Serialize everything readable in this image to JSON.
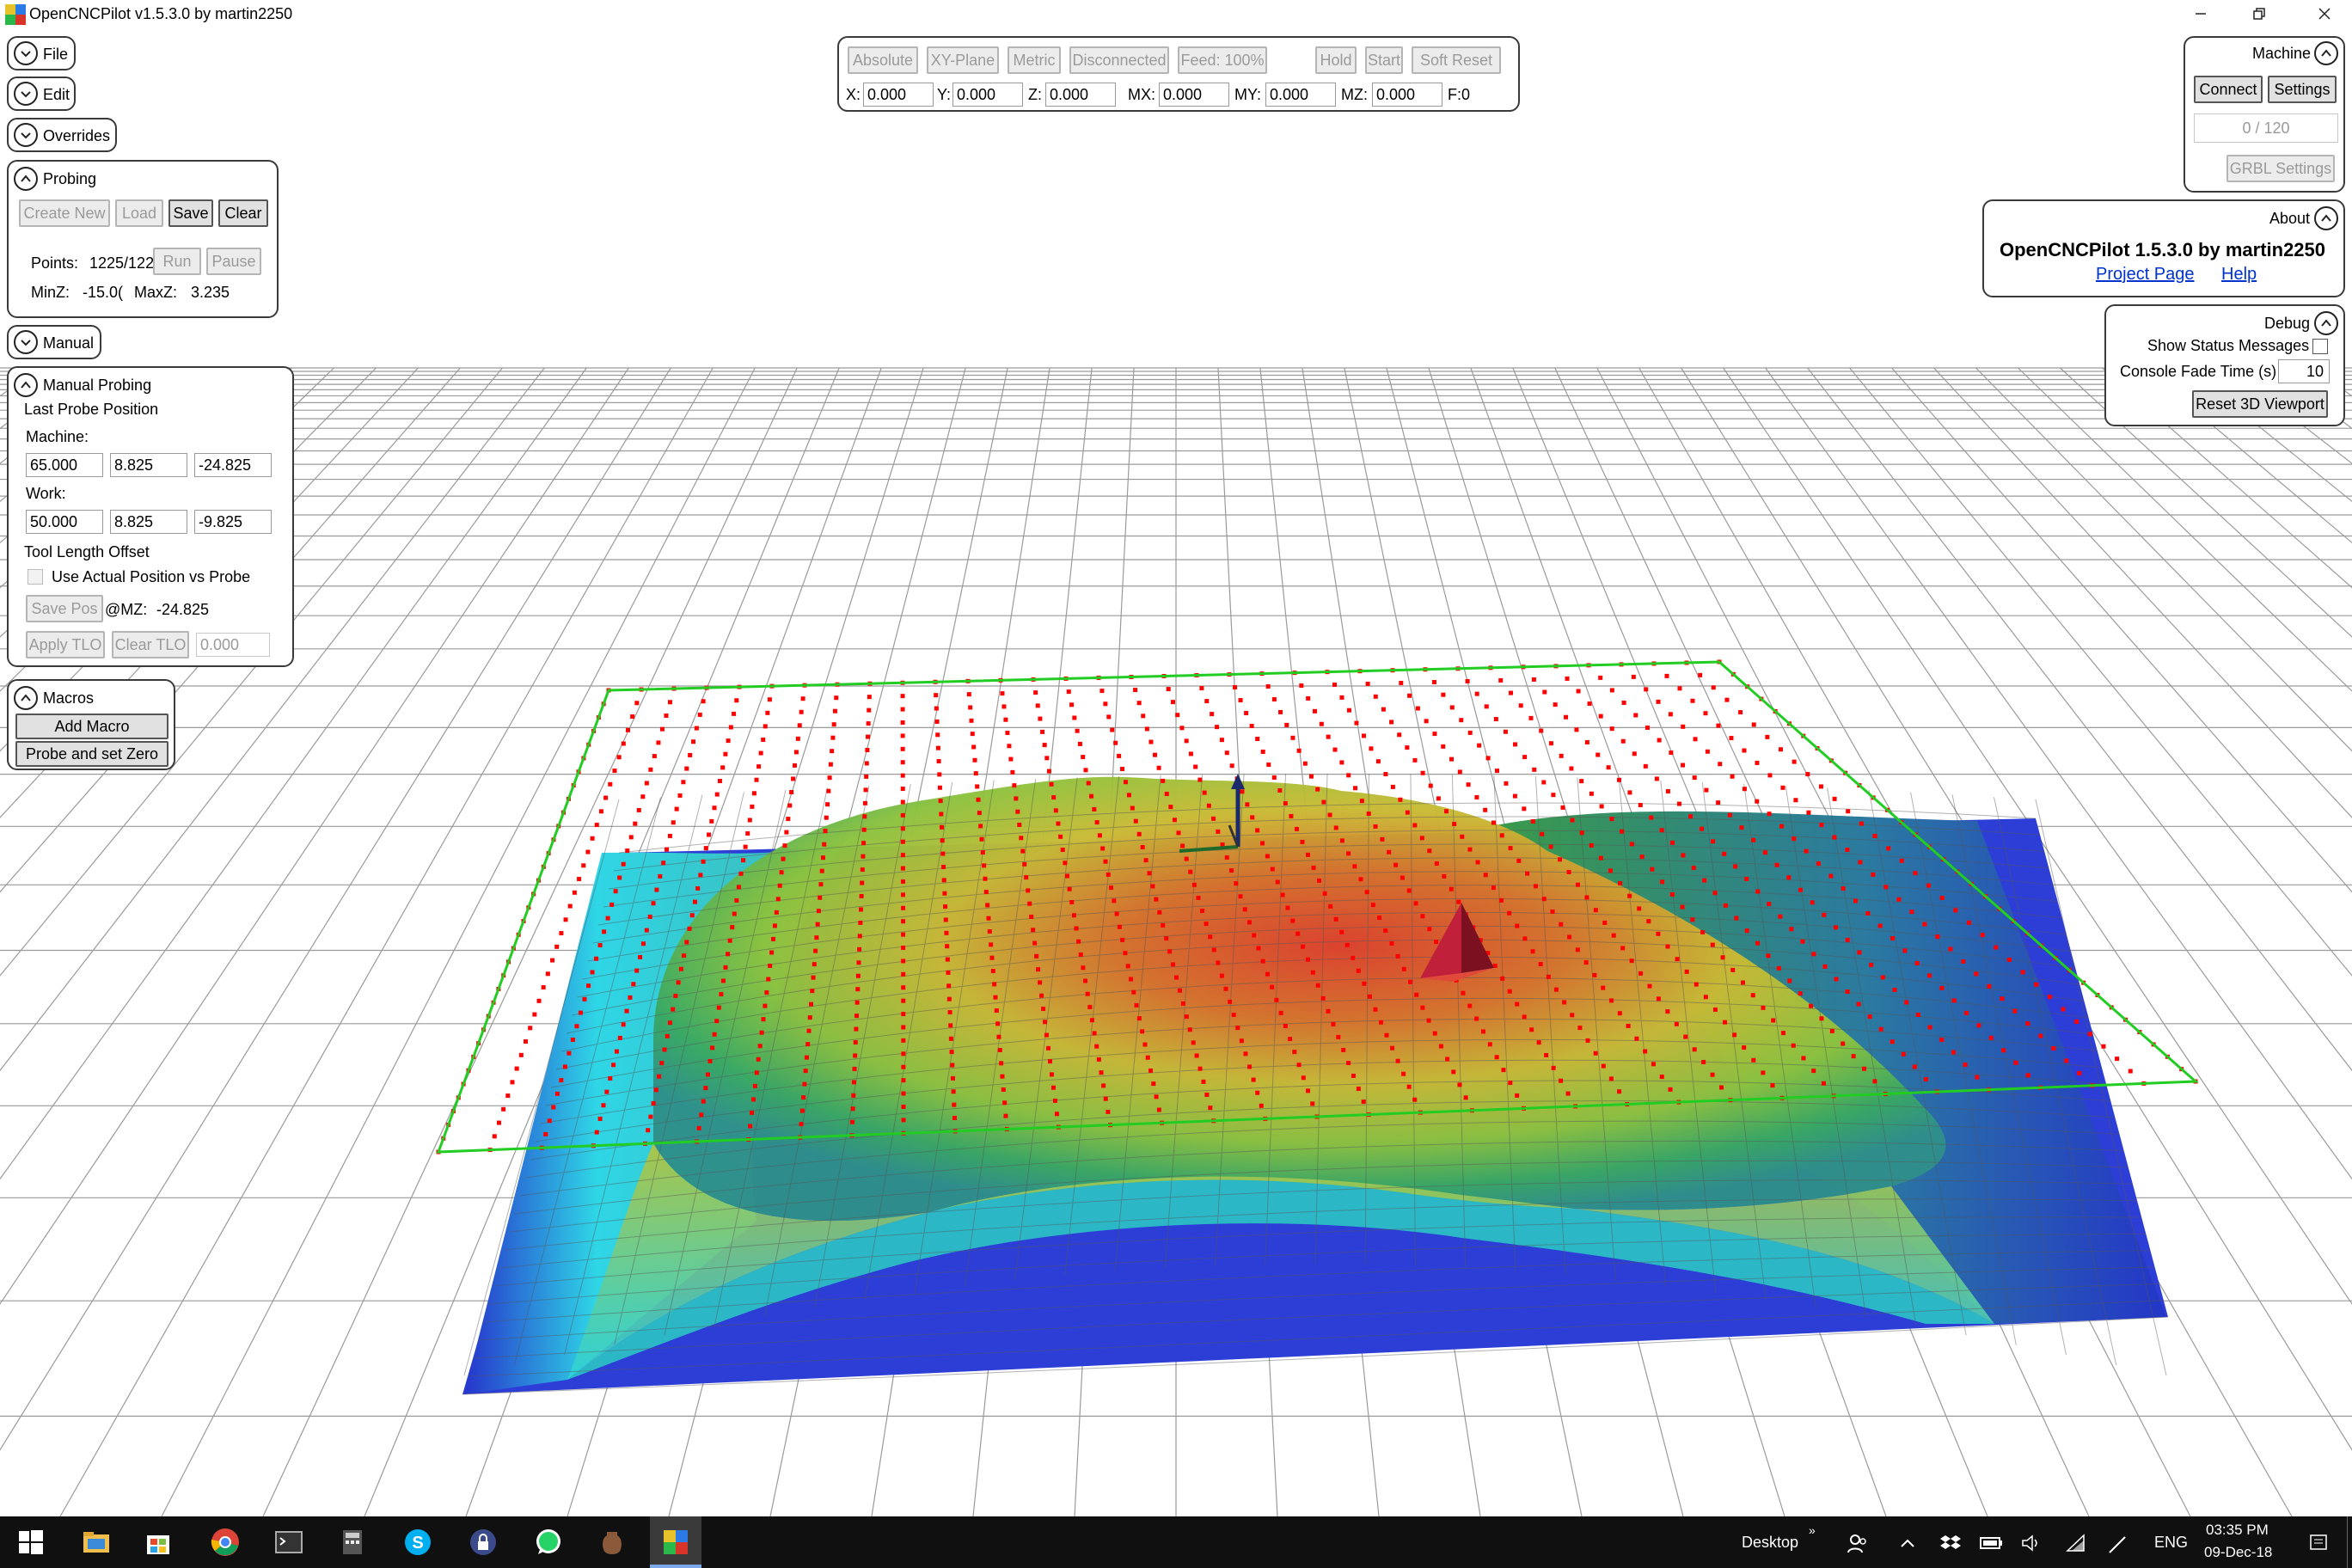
{
  "window": {
    "title": "OpenCNCPilot v1.5.3.0 by martin2250",
    "minimize_icon": "minimize-icon",
    "restore_icon": "restore-icon",
    "close_icon": "close-icon"
  },
  "nav": {
    "file_label": "File",
    "edit_label": "Edit",
    "overrides_label": "Overrides",
    "manual_label": "Manual"
  },
  "probing": {
    "title": "Probing",
    "create_new": "Create New",
    "load": "Load",
    "save": "Save",
    "clear": "Clear",
    "points_label": "Points:",
    "points_value": "1225/122",
    "run": "Run",
    "pause": "Pause",
    "minz_label": "MinZ:",
    "minz_value": "-15.0(",
    "maxz_label": "MaxZ:",
    "maxz_value": "3.235"
  },
  "manual_probing": {
    "title": "Manual Probing",
    "last_probe_position": "Last Probe Position",
    "machine_label": "Machine:",
    "machine_x": "65.000",
    "machine_y": "8.825",
    "machine_z": "-24.825",
    "work_label": "Work:",
    "work_x": "50.000",
    "work_y": "8.825",
    "work_z": "-9.825",
    "tlo_label": "Tool Length Offset",
    "use_actual_label": "Use Actual Position vs Probe",
    "save_pos": "Save Pos",
    "at_mz_label": "@MZ:",
    "at_mz_value": "-24.825",
    "apply_tlo": "Apply TLO",
    "clear_tlo": "Clear TLO",
    "tlo_value": "0.000"
  },
  "macros": {
    "title": "Macros",
    "add_macro": "Add Macro",
    "items": [
      "Probe and set Zero"
    ]
  },
  "status_bar": {
    "buttons": [
      "Absolute",
      "XY-Plane",
      "Metric",
      "Disconnected",
      "Feed: 100%"
    ],
    "hold": "Hold",
    "start": "Start",
    "soft_reset": "Soft Reset",
    "x_label": "X:",
    "x_value": "0.000",
    "y_label": "Y:",
    "y_value": "0.000",
    "z_label": "Z:",
    "z_value": "0.000",
    "mx_label": "MX:",
    "mx_value": "0.000",
    "my_label": "MY:",
    "my_value": "0.000",
    "mz_label": "MZ:",
    "mz_value": "0.000",
    "feed_readout": "F:0"
  },
  "machine": {
    "title": "Machine",
    "connect": "Connect",
    "settings": "Settings",
    "buffer": "0 / 120",
    "grbl_settings": "GRBL Settings"
  },
  "about": {
    "title": "About",
    "app_name": "OpenCNCPilot 1.5.3.0 by martin2250",
    "project_page": "Project Page",
    "help": "Help"
  },
  "debug": {
    "title": "Debug",
    "show_status_messages": "Show Status Messages",
    "console_fade_label": "Console Fade Time (s)",
    "console_fade_value": "10",
    "reset_viewport": "Reset 3D Viewport"
  },
  "taskbar": {
    "icons": [
      "windows-start-icon",
      "file-explorer-icon",
      "store-icon",
      "chrome-icon",
      "terminal-icon",
      "calculator-icon",
      "skype-icon",
      "vpn-lock-icon",
      "whatsapp-icon",
      "vase-app-icon",
      "opencncpilot-icon"
    ],
    "desktop_label": "Desktop",
    "language": "ENG",
    "time": "03:35 PM",
    "date": "09-Dec-18"
  },
  "colors": {
    "height_low": "#2a3bd6",
    "height_mid": "#c8d232",
    "height_high": "#e23a1e",
    "probe_point": "#ff0000",
    "probe_boundary": "#22cc22",
    "link": "#0033cc"
  }
}
